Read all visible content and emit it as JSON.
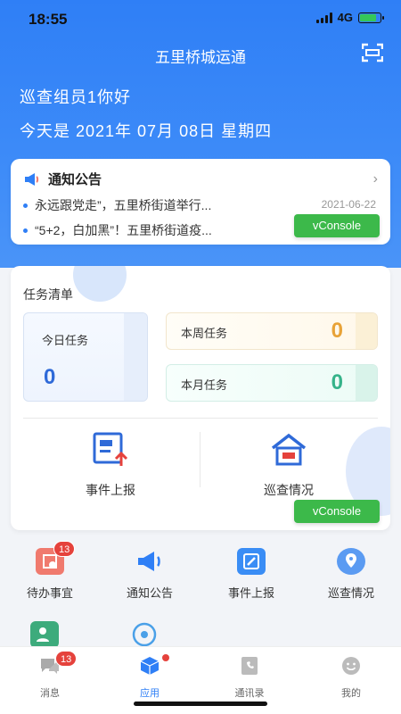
{
  "status": {
    "time": "18:55",
    "network": "4G"
  },
  "header": {
    "title": "五里桥城运通",
    "greeting": "巡查组员1你好",
    "today": "今天是 2021年 07月 08日  星期四"
  },
  "notice": {
    "title": "通知公告",
    "items": [
      {
        "text": "永远跟党走”，五里桥街道举行...",
        "date": "2021-06-22"
      },
      {
        "text": "“5+2，白加黑”！五里桥街道疫..."
      }
    ]
  },
  "vconsole_label": "vConsole",
  "tasks": {
    "title": "任务清单",
    "today": {
      "label": "今日任务",
      "value": "0"
    },
    "week": {
      "label": "本周任务",
      "value": "0"
    },
    "month": {
      "label": "本月任务",
      "value": "0"
    },
    "actions": [
      {
        "label": "事件上报",
        "icon": "report-icon"
      },
      {
        "label": "巡查情况",
        "icon": "patrol-house-icon"
      }
    ]
  },
  "grid": [
    {
      "label": "待办事宜",
      "badge": "13",
      "icon": "todo-icon",
      "color": "#f07a6e"
    },
    {
      "label": "通知公告",
      "icon": "megaphone-icon",
      "color": "#2f7ff6"
    },
    {
      "label": "事件上报",
      "icon": "edit-icon",
      "color": "#3a8df5"
    },
    {
      "label": "巡查情况",
      "icon": "map-pin-icon",
      "color": "#5b9bf2"
    },
    {
      "label": "",
      "icon": "person-icon",
      "color": "#3dab7c"
    },
    {
      "label": "",
      "icon": "eye-icon",
      "color": "#4aa0e8"
    }
  ],
  "tabbar": [
    {
      "label": "消息",
      "badge": "13",
      "icon": "chat-icon"
    },
    {
      "label": "应用",
      "icon": "cube-icon",
      "active": true
    },
    {
      "label": "通讯录",
      "icon": "phone-book-icon"
    },
    {
      "label": "我的",
      "icon": "smile-icon"
    }
  ],
  "colors": {
    "primary": "#2f7ff6",
    "vconsole": "#3cb94a",
    "badge": "#e5423c"
  }
}
